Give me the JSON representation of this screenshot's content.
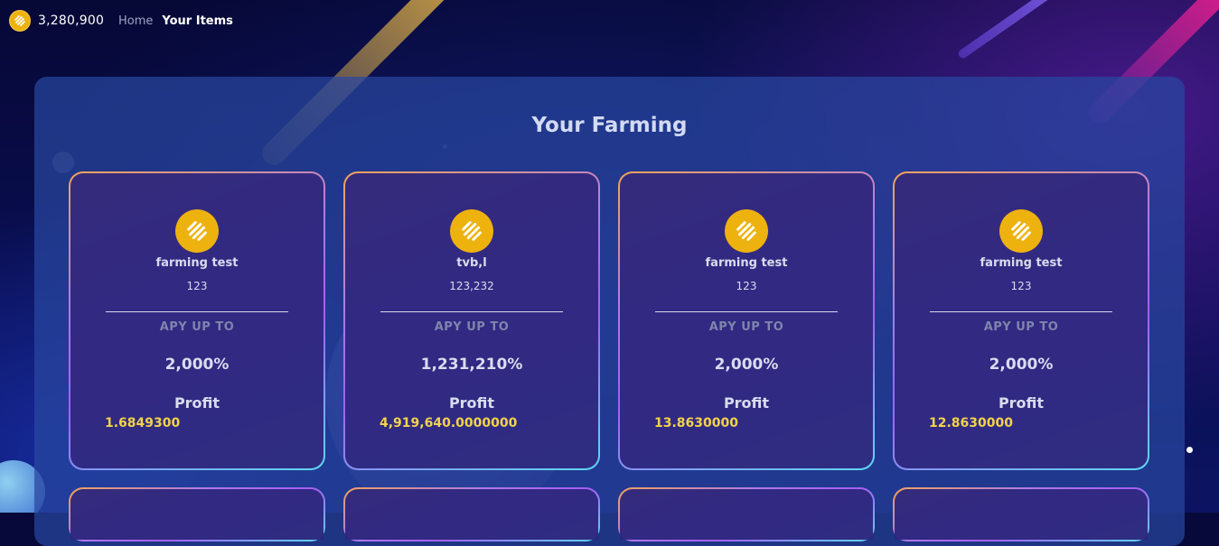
{
  "header": {
    "balance": "3,280,900",
    "nav": {
      "home": "Home",
      "your_items": "Your Items"
    }
  },
  "main": {
    "title": "Your Farming",
    "cards": [
      {
        "name": "farming test",
        "amount": "123",
        "apy_label": "APY UP TO",
        "apy_value": "2,000%",
        "profit_label": "Profit",
        "profit_value": "1.6849300"
      },
      {
        "name": "tvb,l",
        "amount": "123,232",
        "apy_label": "APY UP TO",
        "apy_value": "1,231,210%",
        "profit_label": "Profit",
        "profit_value": "4,919,640.0000000"
      },
      {
        "name": "farming test",
        "amount": "123",
        "apy_label": "APY UP TO",
        "apy_value": "2,000%",
        "profit_label": "Profit",
        "profit_value": "13.8630000"
      },
      {
        "name": "farming test",
        "amount": "123",
        "apy_label": "APY UP TO",
        "apy_value": "2,000%",
        "profit_label": "Profit",
        "profit_value": "12.8630000"
      }
    ]
  },
  "colors": {
    "accent_gold": "#eeb20f",
    "profit_yellow": "#f2d34b",
    "panel_blue": "#28469f"
  },
  "icons": {
    "coin": "coin-icon"
  }
}
